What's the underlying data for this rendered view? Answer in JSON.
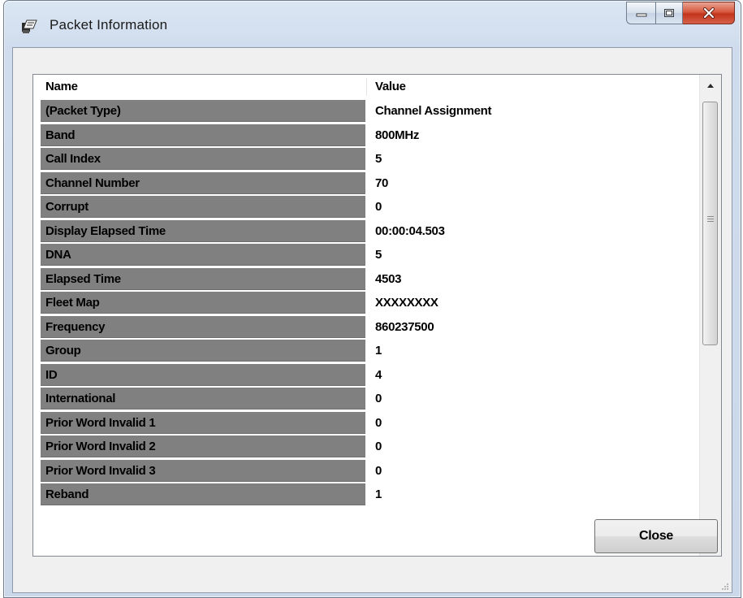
{
  "window": {
    "title": "Packet Information",
    "icon": "packet-icon",
    "caption_buttons": [
      "minimize",
      "maximize",
      "close"
    ]
  },
  "grid": {
    "columns": [
      "Name",
      "Value"
    ],
    "rows": [
      {
        "name": "(Packet Type)",
        "value": "Channel Assignment"
      },
      {
        "name": "Band",
        "value": "800MHz"
      },
      {
        "name": "Call Index",
        "value": "5"
      },
      {
        "name": "Channel Number",
        "value": "70"
      },
      {
        "name": "Corrupt",
        "value": "0"
      },
      {
        "name": "Display Elapsed Time",
        "value": "00:00:04.503"
      },
      {
        "name": "DNA",
        "value": "5"
      },
      {
        "name": "Elapsed Time",
        "value": "4503"
      },
      {
        "name": "Fleet Map",
        "value": "XXXXXXXX"
      },
      {
        "name": "Frequency",
        "value": "860237500"
      },
      {
        "name": "Group",
        "value": "1"
      },
      {
        "name": "ID",
        "value": "4"
      },
      {
        "name": "International",
        "value": "0"
      },
      {
        "name": "Prior Word Invalid 1",
        "value": "0"
      },
      {
        "name": "Prior Word Invalid 2",
        "value": "0"
      },
      {
        "name": "Prior Word Invalid 3",
        "value": "0"
      },
      {
        "name": "Reband",
        "value": "1"
      }
    ]
  },
  "buttons": {
    "close_label": "Close"
  },
  "colors": {
    "name_cell_bg": "#808080",
    "frame": "#cfdced",
    "close_caption": "#c2341b"
  }
}
